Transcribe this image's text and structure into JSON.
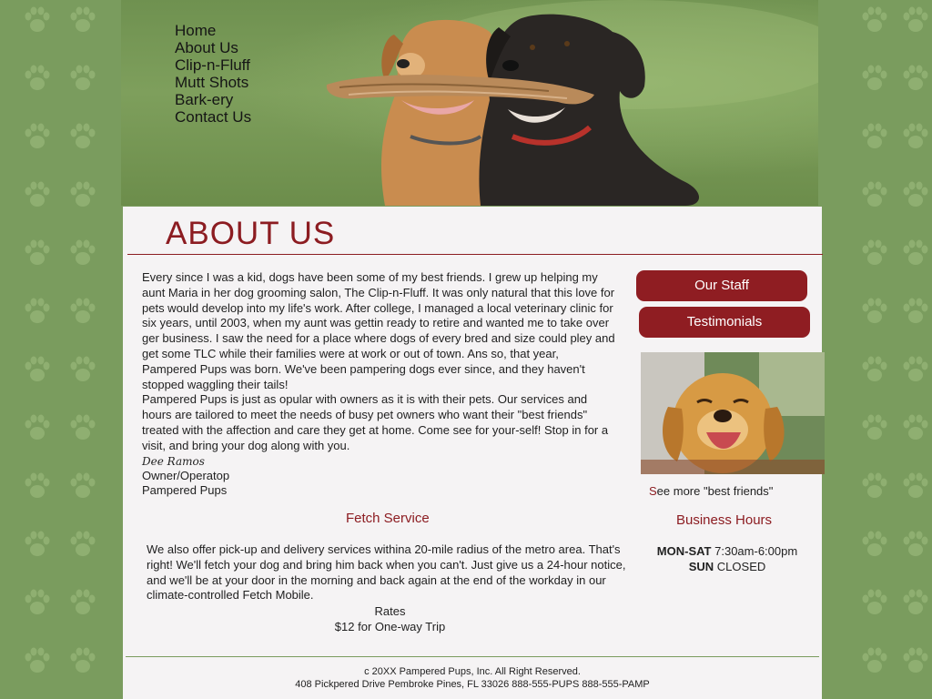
{
  "site": {
    "accent": "#8c1c21",
    "background": "#7a9c5e"
  },
  "nav": [
    "Home",
    "About Us",
    "Clip-n-Fluff",
    "Mutt Shots",
    "Bark-ery",
    "Contact Us"
  ],
  "page_title": "ABOUT US",
  "intro": {
    "paragraph1": "Every since I was a kid, dogs have been some of my best friends. I grew up helping my aunt Maria in her dog grooming salon, The Clip-n-Fluff. It was only natural that this love for pets would develop into my life's work. After college, I managed a local veterinary clinic for six years, until 2003, when my aunt was gettin ready to retire and wanted me to take over ger business. I saw the need for a place where dogs of every bred and size could pley and get some TLC while their families were at work or out of town.  Ans so, that year, Pampered Pups was born. We've been pampering dogs ever since, and they haven't stopped waggling their tails!",
    "paragraph2": "Pampered Pups is just as opular with owners as it is with their pets. Our services and hours are tailored to meet the needs of busy pet owners who want their \"best friends\" treated with the affection and care they get at home. Come see for your-self! Stop in for a visit, and bring your dog along with you.",
    "signature": "Dee Ramos",
    "role": "Owner/Operatop",
    "company": "Pampered Pups"
  },
  "sidebar": {
    "staff_button": "Our Staff",
    "testimonials_button": "Testimonials",
    "see_more_first": "S",
    "see_more_rest": "ee more \"best friends\"",
    "hours_title": "Business Hours",
    "weekday_label": "MON-SAT",
    "weekday_hours": "7:30am-6:00pm",
    "sunday_label": "SUN",
    "sunday_hours": "CLOSED"
  },
  "fetch": {
    "title": "Fetch Service",
    "text": "We also offer pick-up and delivery services withina 20-mile radius of the metro area. That's right! We'll fetch your dog and bring him back when you can't. Just give us a 24-hour notice, and we'll be at your door in the morning and back again at the end of the workday in our climate-controlled Fetch Mobile.",
    "rates_title": "Rates",
    "rate": "$12 for One-way Trip"
  },
  "footer": {
    "copyright": "c 20XX Pampered Pups, Inc. All Right Reserved.",
    "address": "408 Pickpered Drive Pembroke Pines, FL 33026 888-555-PUPS  888-555-PAMP"
  }
}
